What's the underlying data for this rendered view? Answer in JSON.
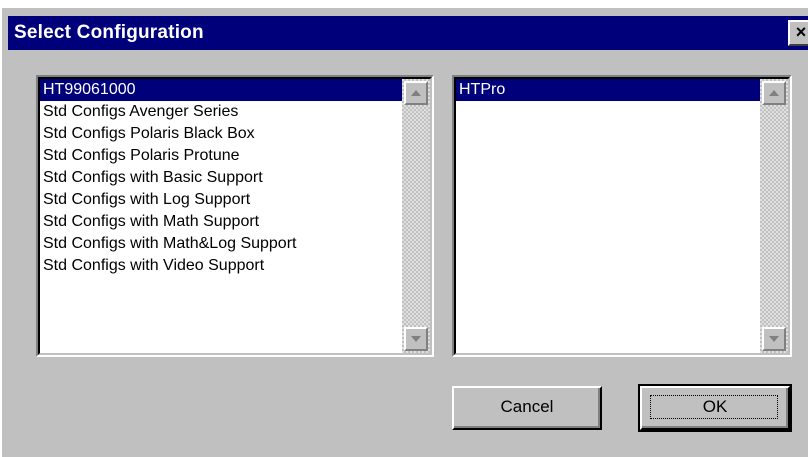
{
  "dialog": {
    "title": "Select Configuration",
    "close_label": "×"
  },
  "left_list": {
    "selected_index": 0,
    "items": [
      "HT99061000",
      "Std Configs Avenger Series",
      "Std Configs Polaris Black Box",
      "Std Configs Polaris Protune",
      "Std Configs with Basic Support",
      "Std Configs with Log Support",
      "Std Configs with Math Support",
      "Std Configs with Math&Log Support",
      "Std Configs with Video Support"
    ]
  },
  "right_list": {
    "selected_index": 0,
    "items": [
      "HTPro"
    ]
  },
  "buttons": {
    "cancel_label": "Cancel",
    "ok_label": "OK"
  },
  "colors": {
    "titlebar": "#00007b",
    "face": "#c0c0c0",
    "selection": "#00007b"
  },
  "icons": {
    "close": "close-icon",
    "scroll_up": "scroll-up-arrow-icon",
    "scroll_down": "scroll-down-arrow-icon"
  }
}
